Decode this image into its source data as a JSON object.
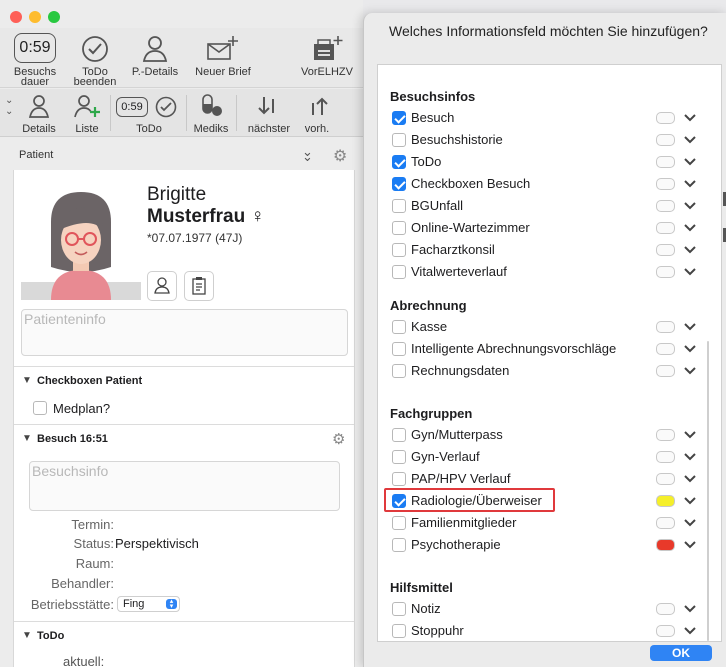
{
  "toolbar": {
    "items": [
      {
        "label": "Besuchs\ndauer",
        "badge": "0:59",
        "icon": "timer-icon"
      },
      {
        "label": "ToDo\nbeenden",
        "icon": "checkmark-circle-icon"
      },
      {
        "label": "P.-Details",
        "icon": "person-icon"
      },
      {
        "label": "Neuer Brief",
        "icon": "envelope-plus-icon"
      },
      {
        "label": "VorELHZV",
        "icon": "printer-plus-icon"
      }
    ]
  },
  "toolbar2": {
    "items": [
      {
        "label": "Details",
        "icon": "person-icon"
      },
      {
        "label": "Liste",
        "icon": "person-plus-icon"
      },
      {
        "label": "ToDo",
        "badge": "0:59",
        "icon": "timer-check-icon"
      },
      {
        "label": "Mediks",
        "icon": "pills-icon"
      },
      {
        "label": "nächster",
        "icon": "sort-down-icon"
      },
      {
        "label": "vorh.",
        "icon": "sort-up-icon"
      }
    ]
  },
  "patient_panel": {
    "header": "Patient",
    "first_name": "Brigitte",
    "last_name": "Musterfrau",
    "gender_symbol": "♀",
    "birth": "*07.07.1977 (47J)",
    "info_placeholder": "Patienteninfo"
  },
  "checkboxen_patient": {
    "title": "Checkboxen Patient",
    "items": [
      {
        "label": "Medplan?",
        "checked": false
      }
    ]
  },
  "besuch": {
    "title": "Besuch 16:51",
    "info_placeholder": "Besuchsinfo",
    "fields": [
      {
        "label": "Termin:",
        "value": ""
      },
      {
        "label": "Status:",
        "value": "Perspektivisch"
      },
      {
        "label": "Raum:",
        "value": ""
      },
      {
        "label": "Behandler:",
        "value": ""
      },
      {
        "label": "Betriebsstätte:",
        "value": "Fing"
      }
    ]
  },
  "todo": {
    "title": "ToDo",
    "field_label": "aktuell:"
  },
  "sheet": {
    "title": "Welches Informationsfeld möchten Sie hinzufügen?",
    "ok_label": "OK",
    "groups": [
      {
        "title": "Besuchsinfos",
        "items": [
          {
            "label": "Besuch",
            "checked": true,
            "color": "#fafafa"
          },
          {
            "label": "Besuchshistorie",
            "checked": false,
            "color": "#fafafa"
          },
          {
            "label": "ToDo",
            "checked": true,
            "color": "#fafafa"
          },
          {
            "label": "Checkboxen Besuch",
            "checked": true,
            "color": "#fafafa"
          },
          {
            "label": "BGUnfall",
            "checked": false,
            "color": "#fafafa"
          },
          {
            "label": "Online-Wartezimmer",
            "checked": false,
            "color": "#fafafa"
          },
          {
            "label": "Facharztkonsil",
            "checked": false,
            "color": "#fafafa"
          },
          {
            "label": "Vitalwerteverlauf",
            "checked": false,
            "color": "#fafafa"
          }
        ]
      },
      {
        "title": "Abrechnung",
        "items": [
          {
            "label": "Kasse",
            "checked": false,
            "color": "#fafafa"
          },
          {
            "label": "Intelligente Abrechnungsvorschläge",
            "checked": false,
            "color": "#fafafa"
          },
          {
            "label": "Rechnungsdaten",
            "checked": false,
            "color": "#fafafa"
          }
        ]
      },
      {
        "title": "Fachgruppen",
        "items": [
          {
            "label": "Gyn/Mutterpass",
            "checked": false,
            "color": "#fafafa"
          },
          {
            "label": "Gyn-Verlauf",
            "checked": false,
            "color": "#fafafa"
          },
          {
            "label": "PAP/HPV Verlauf",
            "checked": false,
            "color": "#fafafa"
          },
          {
            "label": "Radiologie/Überweiser",
            "checked": true,
            "color": "#f5ef2a",
            "highlighted": true
          },
          {
            "label": "Familienmitglieder",
            "checked": false,
            "color": "#fafafa"
          },
          {
            "label": "Psychotherapie",
            "checked": false,
            "color": "#e8392a"
          }
        ]
      },
      {
        "title": "Hilfsmittel",
        "items": [
          {
            "label": "Notiz",
            "checked": false,
            "color": "#fafafa"
          },
          {
            "label": "Stoppuhr",
            "checked": false,
            "color": "#fafafa"
          }
        ]
      }
    ]
  },
  "colors": {
    "accent": "#1a7cf3",
    "highlight": "#e0393c",
    "ok_button": "#2f84f4"
  }
}
